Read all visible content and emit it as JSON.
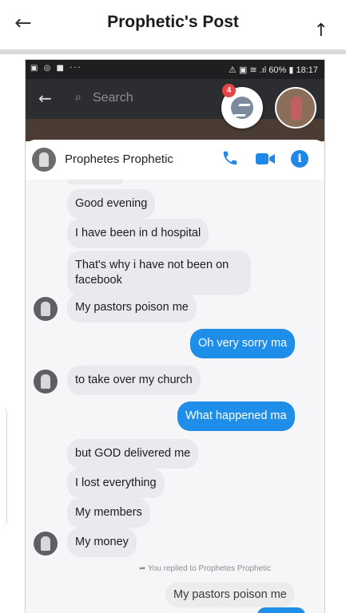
{
  "post": {
    "title": "Prophetic's Post",
    "back_icon": "←",
    "up_icon": "↑"
  },
  "status_bar": {
    "left_icons": "▣ ◎ ■ ···",
    "right_text": "⚠ ▣ ≋ .ıl 60% ▮ 18:17"
  },
  "search": {
    "placeholder": "Search",
    "back_icon": "←",
    "search_icon": "⌕"
  },
  "notification_count": "4",
  "chat": {
    "contact_name": "Prophetes Prophetic",
    "accent_color": "#1f8ee9",
    "messages": [
      {
        "side": "in",
        "text": "Good evening"
      },
      {
        "side": "in",
        "text": "I have been in d hospital"
      },
      {
        "side": "in",
        "line1": "That's why i have not been on",
        "line2": "facebook"
      },
      {
        "side": "in",
        "text": "My pastors poison me"
      },
      {
        "side": "out",
        "text": "Oh very sorry ma"
      },
      {
        "side": "in",
        "text": "to take over my church"
      },
      {
        "side": "out",
        "text": "What happened ma"
      },
      {
        "side": "in",
        "text": "but GOD delivered me"
      },
      {
        "side": "in",
        "text": "I lost everything"
      },
      {
        "side": "in",
        "text": "My members"
      },
      {
        "side": "in",
        "text": "My money"
      }
    ],
    "replied_label": "You replied to Prophetes Prophetic",
    "replied_quote": "My pastors poison me"
  }
}
